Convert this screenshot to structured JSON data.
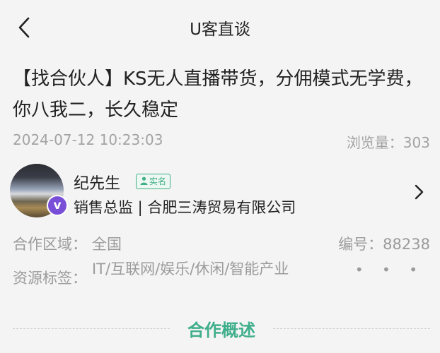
{
  "header": {
    "title": "U客直谈"
  },
  "post": {
    "title": "【找合伙人】KS无人直播带货，分佣模式无学费，你八我二，长久稳定",
    "date": "2024-07-12 10:23:03",
    "views": "浏览量：303"
  },
  "user": {
    "name": "纪先生",
    "verified_label": "实名",
    "role_company": "销售总监 | 合肥三涛贸易有限公司",
    "vip_badge": "v"
  },
  "info": {
    "region_label": "合作区域：",
    "region_value": "全国",
    "code": "编号：88238",
    "tags_label": "资源标签：",
    "tags_value": "IT/互联网/娱乐/休闲/智能产业",
    "more": "• • •"
  },
  "section": {
    "title": "合作概述"
  },
  "colors": {
    "accent": "#3fae8a",
    "muted": "#9b9b9b",
    "vip": "#7a4fd8"
  }
}
